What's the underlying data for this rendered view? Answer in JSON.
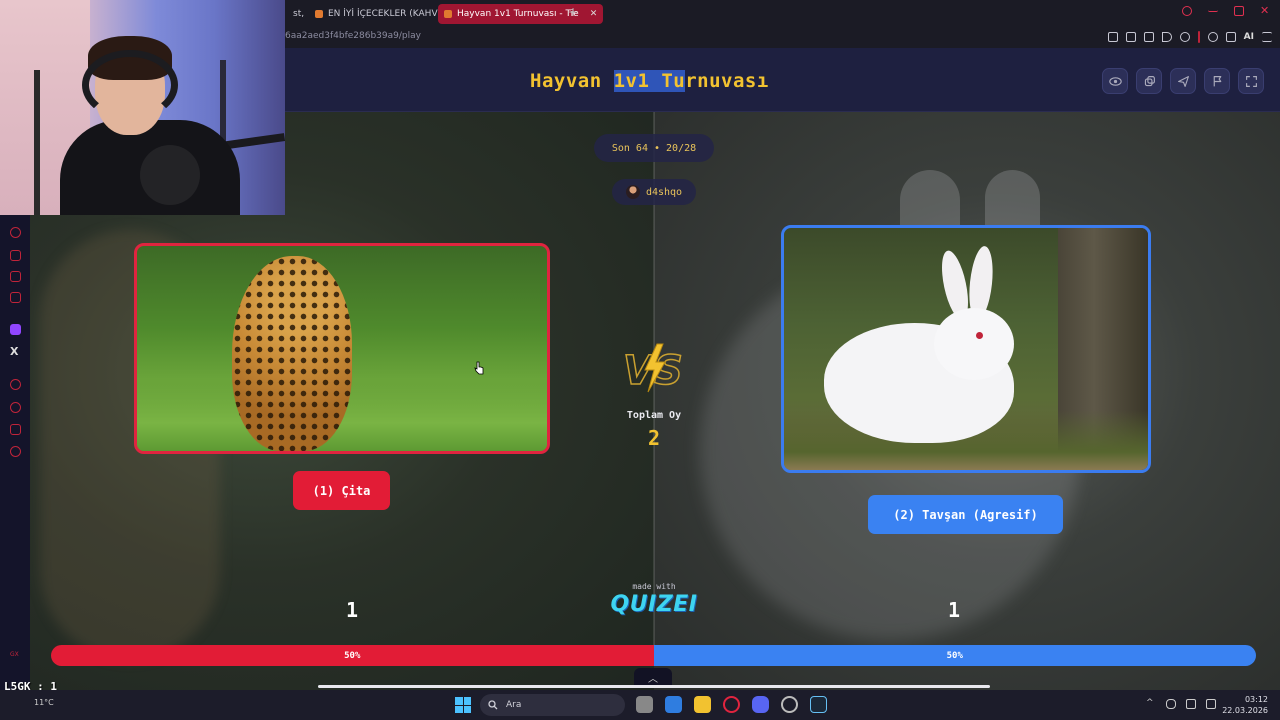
{
  "browser": {
    "tabs": [
      {
        "label": "st,"
      },
      {
        "label": "EN İYİ İÇECEKLER (KAHVE"
      },
      {
        "label": "Hayvan 1v1 Turnuvası - Tie"
      }
    ],
    "url": "6aa2aed3f4bfe286b39a9/play",
    "ai_label": "AI"
  },
  "quiz": {
    "title_part1": "Hayvan ",
    "title_part2": "1v1 Tu",
    "title_part3": "rnuvası",
    "stage": "Son 64 • 20/28",
    "username": "d4shqo",
    "left_option": "(1) Çita",
    "right_option": "(2) Tavşan (Agresif)",
    "total_label": "Toplam Oy",
    "total_value": "2",
    "left_votes": "1",
    "right_votes": "1",
    "left_percent": "50%",
    "right_percent": "50%",
    "left_share": 0.5,
    "made_with": "made with",
    "brand": "QUIZEI",
    "colors": {
      "left": "#e21c36",
      "right": "#3a82f2",
      "accent": "#f2c230"
    }
  },
  "header_icons": [
    "eye-icon",
    "share-icon",
    "send-icon",
    "flag-icon",
    "fullscreen-icon"
  ],
  "overlay": {
    "score": "L5GK : 1"
  },
  "taskbar": {
    "search_label": "Ara",
    "weather": "11°C",
    "time": "03:12",
    "date": "22.03.2026"
  }
}
